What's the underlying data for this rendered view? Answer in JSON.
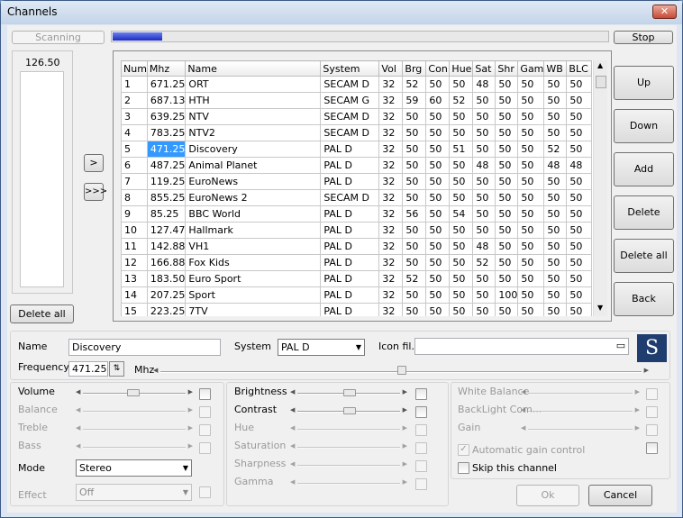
{
  "window": {
    "title": "Channels",
    "close_label": "✕"
  },
  "scan": {
    "status": "Scanning",
    "progress": 0.1,
    "stop_label": "Stop"
  },
  "frequency_list": {
    "header": "126.50",
    "delete_all": "Delete all"
  },
  "arrows": {
    "add_one": ">",
    "add_all": ">>>"
  },
  "table": {
    "columns": [
      "Num",
      "Mhz",
      "Name",
      "System",
      "Vol",
      "Brg",
      "Con",
      "Hue",
      "Sat",
      "Shr",
      "Gam",
      "WB",
      "BLC"
    ],
    "rows": [
      [
        "1",
        "671.25",
        "ORT",
        "SECAM D",
        "32",
        "52",
        "50",
        "50",
        "48",
        "50",
        "50",
        "50",
        "50"
      ],
      [
        "2",
        "687.13",
        "HTH",
        "SECAM G",
        "32",
        "59",
        "60",
        "52",
        "50",
        "50",
        "50",
        "50",
        "50"
      ],
      [
        "3",
        "639.25",
        "NTV",
        "SECAM D",
        "32",
        "50",
        "50",
        "50",
        "50",
        "50",
        "50",
        "50",
        "50"
      ],
      [
        "4",
        "783.25",
        "NTV2",
        "SECAM D",
        "32",
        "50",
        "50",
        "50",
        "50",
        "50",
        "50",
        "50",
        "50"
      ],
      [
        "5",
        "471.25",
        "Discovery",
        "PAL D",
        "32",
        "50",
        "50",
        "51",
        "50",
        "50",
        "50",
        "52",
        "50"
      ],
      [
        "6",
        "487.25",
        "Animal Planet",
        "PAL D",
        "32",
        "50",
        "50",
        "50",
        "48",
        "50",
        "50",
        "48",
        "48"
      ],
      [
        "7",
        "119.25",
        "EuroNews",
        "PAL D",
        "32",
        "50",
        "50",
        "50",
        "50",
        "50",
        "50",
        "50",
        "50"
      ],
      [
        "8",
        "855.25",
        "EuroNews 2",
        "SECAM D",
        "32",
        "50",
        "50",
        "50",
        "50",
        "50",
        "50",
        "50",
        "50"
      ],
      [
        "9",
        "85.25",
        "BBC World",
        "PAL D",
        "32",
        "56",
        "50",
        "54",
        "50",
        "50",
        "50",
        "50",
        "50"
      ],
      [
        "10",
        "127.47",
        "Hallmark",
        "PAL D",
        "32",
        "50",
        "50",
        "50",
        "50",
        "50",
        "50",
        "50",
        "50"
      ],
      [
        "11",
        "142.88",
        "VH1",
        "PAL D",
        "32",
        "50",
        "50",
        "50",
        "48",
        "50",
        "50",
        "50",
        "50"
      ],
      [
        "12",
        "166.88",
        "Fox Kids",
        "PAL D",
        "32",
        "50",
        "50",
        "50",
        "52",
        "50",
        "50",
        "50",
        "50"
      ],
      [
        "13",
        "183.50",
        "Euro Sport",
        "PAL D",
        "32",
        "52",
        "50",
        "50",
        "50",
        "50",
        "50",
        "50",
        "50"
      ],
      [
        "14",
        "207.25",
        "Sport",
        "PAL D",
        "32",
        "50",
        "50",
        "50",
        "50",
        "100",
        "50",
        "50",
        "50"
      ],
      [
        "15",
        "223.25",
        "7TV",
        "PAL D",
        "32",
        "50",
        "50",
        "50",
        "50",
        "50",
        "50",
        "50",
        "50"
      ]
    ]
  },
  "side_buttons": {
    "up": "Up",
    "down": "Down",
    "add": "Add",
    "delete": "Delete",
    "delete_all": "Delete all",
    "back": "Back"
  },
  "details": {
    "name_label": "Name",
    "name_value": "Discovery",
    "system_label": "System",
    "system_value": "PAL D",
    "icon_label": "Icon fil...",
    "freq_label": "Frequency",
    "freq_value": "471.25",
    "freq_unit": "Mhz",
    "logo_letter": "S"
  },
  "audio": {
    "volume": "Volume",
    "balance": "Balance",
    "treble": "Treble",
    "bass": "Bass",
    "mode_label": "Mode",
    "mode_value": "Stereo",
    "effect_label": "Effect",
    "effect_value": "Off"
  },
  "video": {
    "brightness": "Brightness",
    "contrast": "Contrast",
    "hue": "Hue",
    "saturation": "Saturation",
    "sharpness": "Sharpness",
    "gamma": "Gamma"
  },
  "advanced": {
    "white_balance": "White Balance",
    "backlight": "BackLight Com...",
    "gain": "Gain",
    "agc": "Automatic gain control",
    "skip": "Skip this channel"
  },
  "dialog": {
    "ok": "Ok",
    "cancel": "Cancel"
  }
}
